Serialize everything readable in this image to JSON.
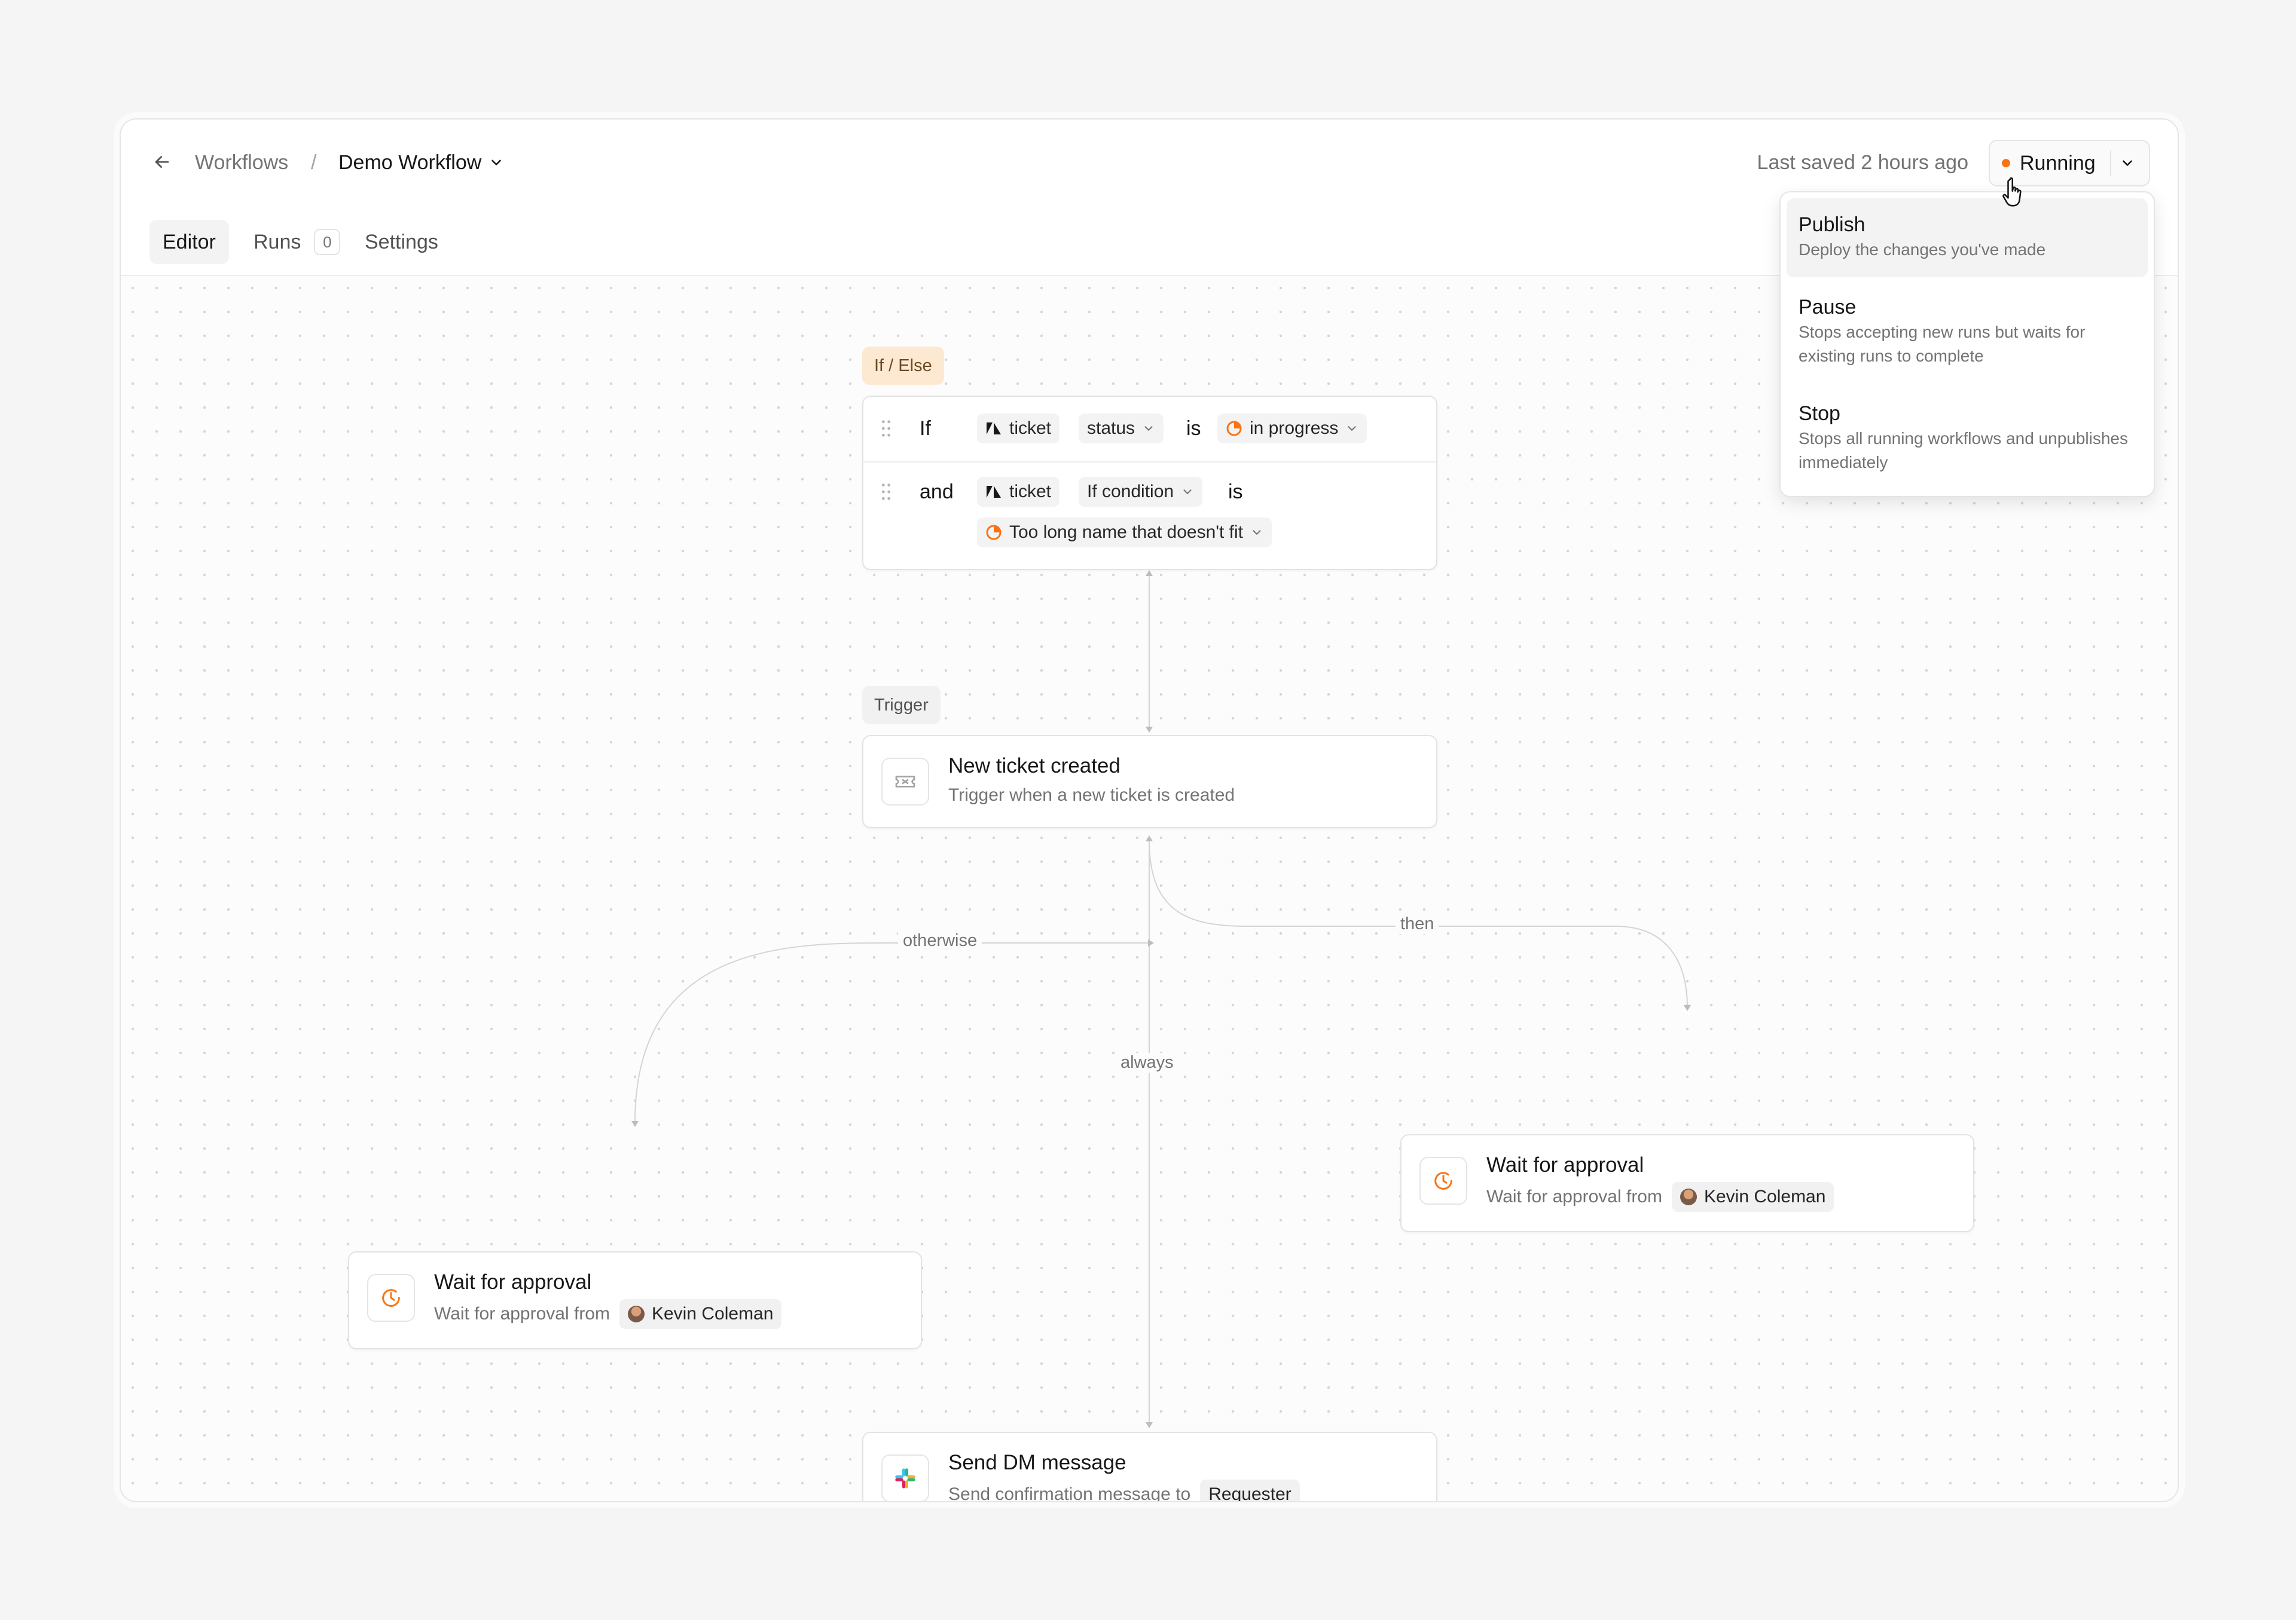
{
  "breadcrumb": {
    "root": "Workflows",
    "separator": "/",
    "current": "Demo Workflow"
  },
  "header": {
    "last_saved": "Last saved 2 hours ago",
    "status": "Running",
    "status_color": "#f97316"
  },
  "tabs": [
    {
      "label": "Editor",
      "active": true
    },
    {
      "label": "Runs",
      "count": "0"
    },
    {
      "label": "Settings"
    }
  ],
  "status_menu": {
    "items": [
      {
        "title": "Publish",
        "description": "Deploy the changes you've made"
      },
      {
        "title": "Pause",
        "description": "Stops accepting new runs but waits for existing runs to complete"
      },
      {
        "title": "Stop",
        "description": "Stops all running workflows and unpublishes immediately"
      }
    ]
  },
  "ifelse": {
    "tag": "If / Else",
    "row1": {
      "keyword": "If",
      "object": "ticket",
      "field": "status",
      "operator": "is",
      "value": "in progress"
    },
    "row2": {
      "keyword": "and",
      "object": "ticket",
      "field": "If condition",
      "operator": "is",
      "value": "Too long name that doesn't fit"
    }
  },
  "trigger": {
    "tag": "Trigger",
    "title": "New ticket created",
    "subtitle": "Trigger when a new ticket is created",
    "icon": "ticket-icon"
  },
  "edges": {
    "otherwise": "otherwise",
    "then": "then",
    "always": "always"
  },
  "approval_right": {
    "title": "Wait for approval",
    "subtitle": "Wait for approval from",
    "person": "Kevin Coleman",
    "icon": "clock-icon"
  },
  "approval_left": {
    "title": "Wait for approval",
    "subtitle": "Wait for approval from",
    "person": "Kevin Coleman",
    "icon": "clock-icon"
  },
  "send_dm": {
    "title": "Send DM message",
    "subtitle": "Send confirmation message to",
    "recipient": "Requester",
    "icon": "slack-icon"
  }
}
